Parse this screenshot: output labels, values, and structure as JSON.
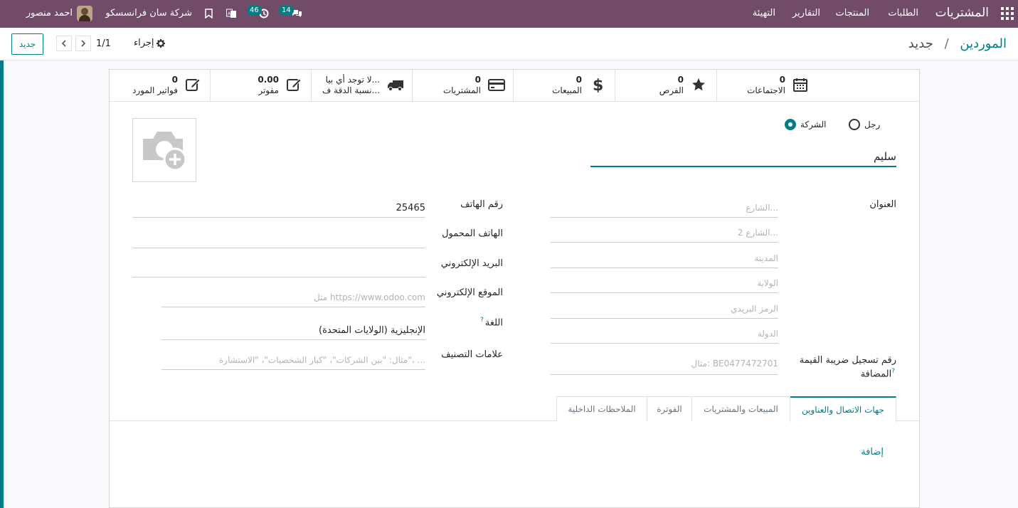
{
  "navbar": {
    "app_title": "المشتريات",
    "menus": [
      "الطلبات",
      "المنتجات",
      "التقارير",
      "التهيئة"
    ],
    "company": "شركة سان فرانسسكو",
    "user": "احمد منصور",
    "messages_count": "14",
    "activities_count": "46"
  },
  "control_panel": {
    "breadcrumb_root": "الموردين",
    "breadcrumb_sep": "/",
    "breadcrumb_current": "جديد",
    "new_button": "جديد",
    "pager_value": "1/1",
    "action_label": "إجراء"
  },
  "stat_buttons": [
    {
      "value": "0",
      "label": "الاجتماعات",
      "icon": "calendar-icon"
    },
    {
      "value": "0",
      "label": "الفرص",
      "icon": "star-icon"
    },
    {
      "value": "0",
      "label": "المبيعات",
      "icon": "dollar-icon"
    },
    {
      "value": "0",
      "label": "المشتريات",
      "icon": "credit-card-icon"
    },
    {
      "value": "لا توجد أي بيا...",
      "label": "نسبة الدقة ف...",
      "icon": "truck-icon"
    },
    {
      "value": "0.00",
      "label": "مفوتر",
      "icon": "edit-icon"
    },
    {
      "value": "0",
      "label": "فواتير المورد",
      "icon": "edit-icon"
    }
  ],
  "form": {
    "company_type": {
      "individual": "رجل",
      "company": "الشركة",
      "selected": "company"
    },
    "name": "سليم",
    "address_label": "العنوان",
    "street_placeholder": "الشارع...",
    "street2_placeholder": "الشارع 2...",
    "city_placeholder": "المدينة",
    "state_placeholder": "الولاية",
    "zip_placeholder": "الرمز البريدي",
    "country_placeholder": "الدولة",
    "vat_label_line1": "رقم تسجيل ضريبة القيمة",
    "vat_label_line2": "المضافة",
    "vat_placeholder": "مثال: BE0477472701",
    "phone_label": "رقم الهاتف",
    "phone_value": "25465",
    "mobile_label": "الهاتف المحمول",
    "email_label": "البريد الإلكتروني",
    "website_label": "الموقع الإلكتروني",
    "website_placeholder": "مثل https://www.odoo.com",
    "language_label": "اللغة",
    "language_value": "الإنجليزية (الولايات المتحدة)",
    "tags_label": "علامات التصنيف",
    "tags_placeholder": "مثال: \"بين الشركات\"، \"كبار الشخصيات\"، \"الاستشارة\"، ...",
    "help_mark": "?"
  },
  "tabs": [
    {
      "label": "جهات الاتصال والعناوين",
      "active": true
    },
    {
      "label": "المبيعات والمشتريات",
      "active": false
    },
    {
      "label": "الفوترة",
      "active": false
    },
    {
      "label": "الملاحظات الداخلية",
      "active": false
    }
  ],
  "add_line": "إضافة",
  "colors": {
    "navbar": "#714b67",
    "accent": "#017e84"
  }
}
